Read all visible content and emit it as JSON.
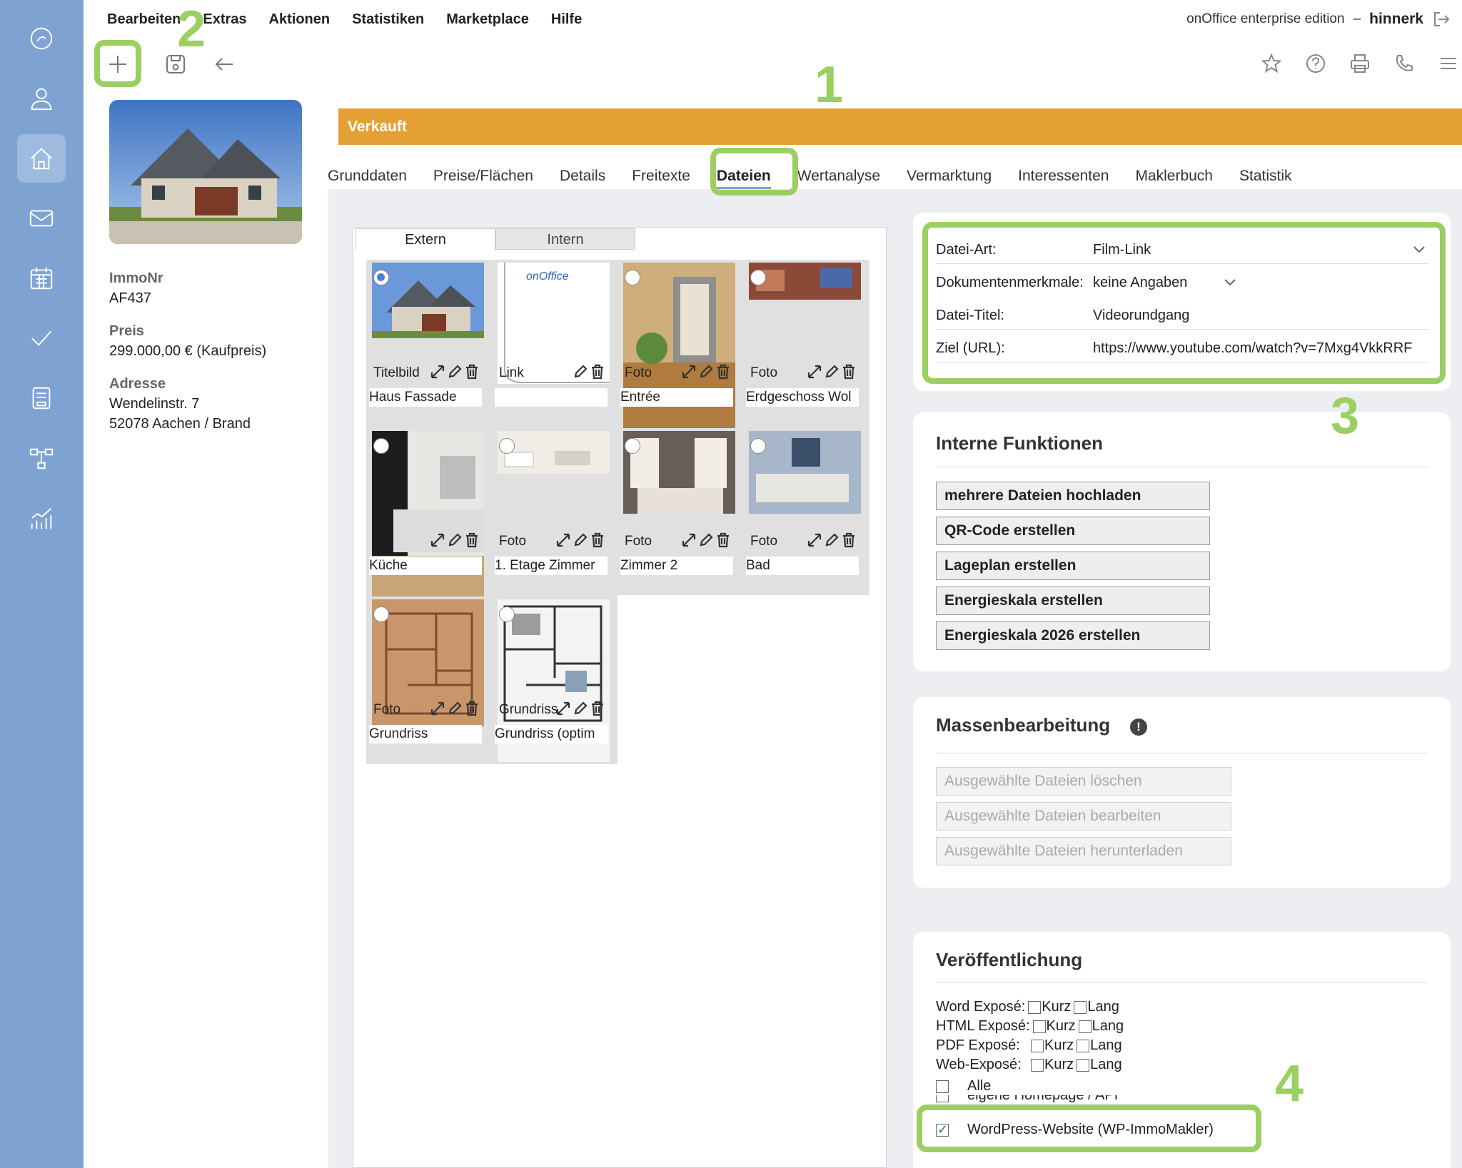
{
  "menu": [
    "Bearbeiten",
    "Extras",
    "Aktionen",
    "Statistiken",
    "Marketplace",
    "Hilfe"
  ],
  "topright": {
    "edition": "onOffice enterprise edition",
    "separator": "–",
    "user": "hinnerk"
  },
  "annotations": [
    "1",
    "2",
    "3",
    "4"
  ],
  "property": {
    "immonr_label": "ImmoNr",
    "immonr": "AF437",
    "preis_label": "Preis",
    "preis": "299.000,00 € (Kaufpreis)",
    "adresse_label": "Adresse",
    "adresse_line1": "Wendelinstr. 7",
    "adresse_line2": "52078 Aachen / Brand"
  },
  "status": "Verkauft",
  "tabs": [
    "Grunddaten",
    "Preise/Flächen",
    "Details",
    "Freitexte",
    "Dateien",
    "Wertanalyse",
    "Vermarktung",
    "Interessenten",
    "Maklerbuch",
    "Statistik"
  ],
  "gallery": {
    "tab_extern": "Extern",
    "tab_intern": "Intern",
    "files": [
      {
        "type": "Titelbild",
        "name": "Haus Fassade",
        "selected": true
      },
      {
        "type": "Link",
        "name": "",
        "selected": false
      },
      {
        "type": "Foto",
        "name": "Entrée",
        "selected": false
      },
      {
        "type": "Foto",
        "name": "Erdgeschoss Wol",
        "selected": false
      },
      {
        "type": "",
        "name": "Küche",
        "selected": false
      },
      {
        "type": "Foto",
        "name": "1. Etage Zimmer",
        "selected": false
      },
      {
        "type": "Foto",
        "name": "Zimmer 2",
        "selected": false
      },
      {
        "type": "Foto",
        "name": "Bad",
        "selected": false
      },
      {
        "type": "Foto",
        "name": "Grundriss",
        "selected": false
      },
      {
        "type": "Grundriss",
        "name": "Grundriss (optim",
        "selected": false
      }
    ]
  },
  "file_form": {
    "datei_art_label": "Datei-Art:",
    "datei_art": "Film-Link",
    "dokument_label": "Dokumentenmerkmale:",
    "dokument": "keine Angaben",
    "titel_label": "Datei-Titel:",
    "titel": "Videorundgang",
    "ziel_label": "Ziel (URL):",
    "ziel": "https://www.youtube.com/watch?v=7Mxg4VkkRRF"
  },
  "interne": {
    "title": "Interne Funktionen",
    "buttons": [
      "mehrere Dateien hochladen",
      "QR-Code erstellen",
      "Lageplan erstellen",
      "Energieskala erstellen",
      "Energieskala 2026 erstellen"
    ]
  },
  "massen": {
    "title": "Massenbearbeitung",
    "buttons": [
      "Ausgewählte Dateien löschen",
      "Ausgewählte Dateien bearbeiten",
      "Ausgewählte Dateien herunterladen"
    ]
  },
  "publish": {
    "title": "Veröffentlichung",
    "rows": [
      {
        "label": "Word Exposé:",
        "kurz": "Kurz",
        "lang": "Lang"
      },
      {
        "label": "HTML Exposé:",
        "kurz": "Kurz",
        "lang": "Lang"
      },
      {
        "label": "PDF Exposé:",
        "kurz": "Kurz",
        "lang": "Lang"
      },
      {
        "label": "Web-Exposé:",
        "kurz": "Kurz",
        "lang": "Lang"
      }
    ],
    "alle": "Alle",
    "homepage": "eigene Homepage / API",
    "wordpress": "WordPress-Website (WP-ImmoMakler)",
    "wordpress_checked": true
  },
  "colors": {
    "rail": "#7ea3d3",
    "status": "#e5a035",
    "highlight": "#9ccf62",
    "tab_underline": "#7ea3d3"
  }
}
